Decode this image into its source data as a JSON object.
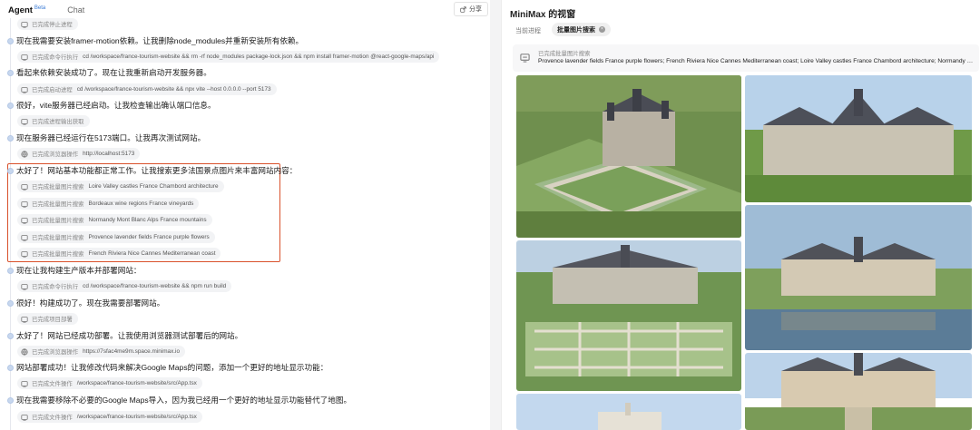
{
  "left": {
    "tabs": {
      "agent": "Agent",
      "beta": "Beta",
      "chat": "Chat"
    },
    "share_label": "分享",
    "first_chip": {
      "label": "已完成停止进程",
      "detail": ""
    },
    "timeline": [
      {
        "text": "现在我需要安装framer-motion依赖。让我删除node_modules并重新安装所有依赖。",
        "chips": [
          {
            "label": "已完成命令行执行",
            "detail": "cd /workspace/france-tourism-website && rm -rf node_modules package-lock.json && npm install framer-motion @react-google-maps/api"
          }
        ]
      },
      {
        "text": "看起来依赖安装成功了。现在让我重新启动开发服务器。",
        "chips": [
          {
            "label": "已完成启动进程",
            "detail": "cd /workspace/france-tourism-website && npx vite --host 0.0.0.0 --port 5173"
          }
        ]
      },
      {
        "text": "很好，vite服务器已经启动。让我检查输出确认端口信息。",
        "chips": [
          {
            "label": "已完成进程输出获取",
            "detail": ""
          }
        ]
      },
      {
        "text": "现在服务器已经运行在5173端口。让我再次测试网站。",
        "chips": [
          {
            "label": "已完成浏览器操作",
            "detail": "http://localhost:5173"
          }
        ]
      },
      {
        "text": "太好了！网站基本功能都正常工作。让我搜索更多法国景点图片来丰富网站内容：",
        "chips": [
          {
            "label": "已完成批量图片搜索",
            "detail": "Loire Valley castles France Chambord architecture"
          },
          {
            "label": "已完成批量图片搜索",
            "detail": "Bordeaux wine regions France vineyards"
          },
          {
            "label": "已完成批量图片搜索",
            "detail": "Normandy Mont Blanc Alps France mountains"
          },
          {
            "label": "已完成批量图片搜索",
            "detail": "Provence lavender fields France purple flowers"
          },
          {
            "label": "已完成批量图片搜索",
            "detail": "French Riviera Nice Cannes Mediterranean coast"
          }
        ]
      },
      {
        "text": "现在让我构建生产版本并部署网站：",
        "chips": [
          {
            "label": "已完成命令行执行",
            "detail": "cd /workspace/france-tourism-website && npm run build"
          }
        ]
      },
      {
        "text": "很好！构建成功了。现在我需要部署网站。",
        "chips": [
          {
            "label": "已完成项目部署",
            "detail": ""
          }
        ]
      },
      {
        "text": "太好了！网站已经成功部署。让我使用浏览器测试部署后的网站。",
        "chips": [
          {
            "label": "已完成浏览器操作",
            "detail": "https://7sfac4me9m.space.minimax.io"
          }
        ]
      },
      {
        "text": "网站部署成功！让我修改代码来解决Google Maps的问题，添加一个更好的地址显示功能：",
        "chips": [
          {
            "label": "已完成文件操作",
            "detail": "/workspace/france-tourism-website/src/App.tsx"
          }
        ]
      },
      {
        "text": "现在我需要移除不必要的Google Maps导入，因为我已经用一个更好的地址显示功能替代了地图。",
        "chips": [
          {
            "label": "已完成文件操作",
            "detail": "/workspace/france-tourism-website/src/App.tsx"
          }
        ]
      }
    ]
  },
  "right": {
    "title": "MiniMax 的视窗",
    "tabs": {
      "current": "当前进程",
      "active": "批量图片搜索"
    },
    "search": {
      "label": "已完成批量图片搜索",
      "query": "Provence lavender fields France purple flowers; French Riviera Nice Cannes Mediterranean coast; Loire Valley castles France Chambord architecture; Normandy Mont Blanc Alps France mountains"
    }
  }
}
